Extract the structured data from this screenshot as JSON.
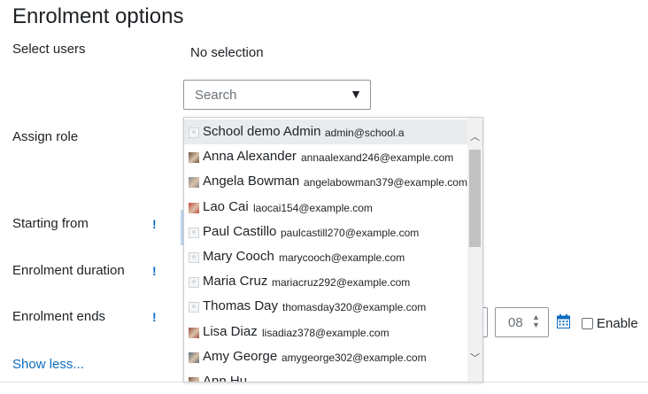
{
  "section": {
    "title": "Enrolment options"
  },
  "labels": {
    "select_users": "Select users",
    "assign_role": "Assign role",
    "starting_from": "Starting from",
    "enrolment_duration": "Enrolment duration",
    "enrolment_ends": "Enrolment ends",
    "required_mark": "!"
  },
  "user_selector": {
    "selection_text": "No selection",
    "search_placeholder": "Search",
    "dropdown_arrow": "▼",
    "options": [
      {
        "name": "School demo Admin",
        "email": "admin@school.a",
        "avatar": "default"
      },
      {
        "name": "Anna Alexander",
        "email": "annaalexand246@example.com",
        "avatar": "photo"
      },
      {
        "name": "Angela Bowman",
        "email": "angelabowman379@example.com",
        "avatar": "photo"
      },
      {
        "name": "Lao Cai",
        "email": "laocai154@example.com",
        "avatar": "photo"
      },
      {
        "name": "Paul Castillo",
        "email": "paulcastill270@example.com",
        "avatar": "default"
      },
      {
        "name": "Mary Cooch",
        "email": "marycooch@example.com",
        "avatar": "default"
      },
      {
        "name": "Maria Cruz",
        "email": "mariacruz292@example.com",
        "avatar": "default"
      },
      {
        "name": "Thomas Day",
        "email": "thomasday320@example.com",
        "avatar": "default"
      },
      {
        "name": "Lisa Diaz",
        "email": "lisadiaz378@example.com",
        "avatar": "photo"
      },
      {
        "name": "Amy George",
        "email": "amygeorge302@example.com",
        "avatar": "photo"
      },
      {
        "name": "Ann Hu",
        "email": "",
        "avatar": "photo"
      }
    ]
  },
  "enrolment_ends": {
    "minute": "08",
    "enable_label": "Enable"
  },
  "links": {
    "show_less": "Show less..."
  },
  "colors": {
    "link": "#0f6cbf",
    "text": "#1d2125",
    "active_option_bg": "#e9ecef",
    "avatar_photo_tones": [
      "#6b4f3a",
      "#8a8a8a",
      "#c7453a",
      "#a05040",
      "#5a6a7a",
      "#7a5a4a"
    ]
  }
}
